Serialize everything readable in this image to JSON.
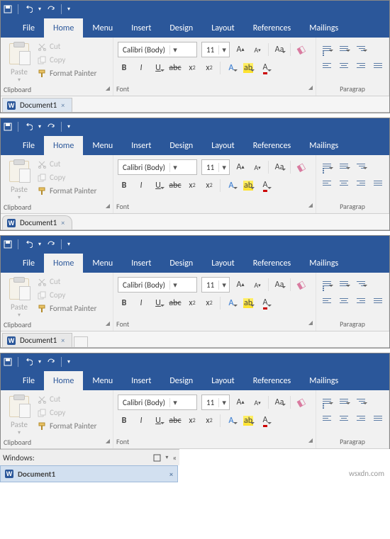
{
  "tabs": [
    "File",
    "Home",
    "Menu",
    "Insert",
    "Design",
    "Layout",
    "References",
    "Mailings"
  ],
  "activeTab": "Home",
  "clipboard": {
    "paste": "Paste",
    "cut": "Cut",
    "copy": "Copy",
    "formatPainter": "Format Painter",
    "label": "Clipboard"
  },
  "font": {
    "name": "Calibri (Body)",
    "size": "11",
    "label": "Font"
  },
  "paragraph": {
    "label": "Paragrap"
  },
  "doc": {
    "name": "Document1"
  },
  "winPane": {
    "title": "Windows:"
  },
  "watermark": "wsxdn.com"
}
